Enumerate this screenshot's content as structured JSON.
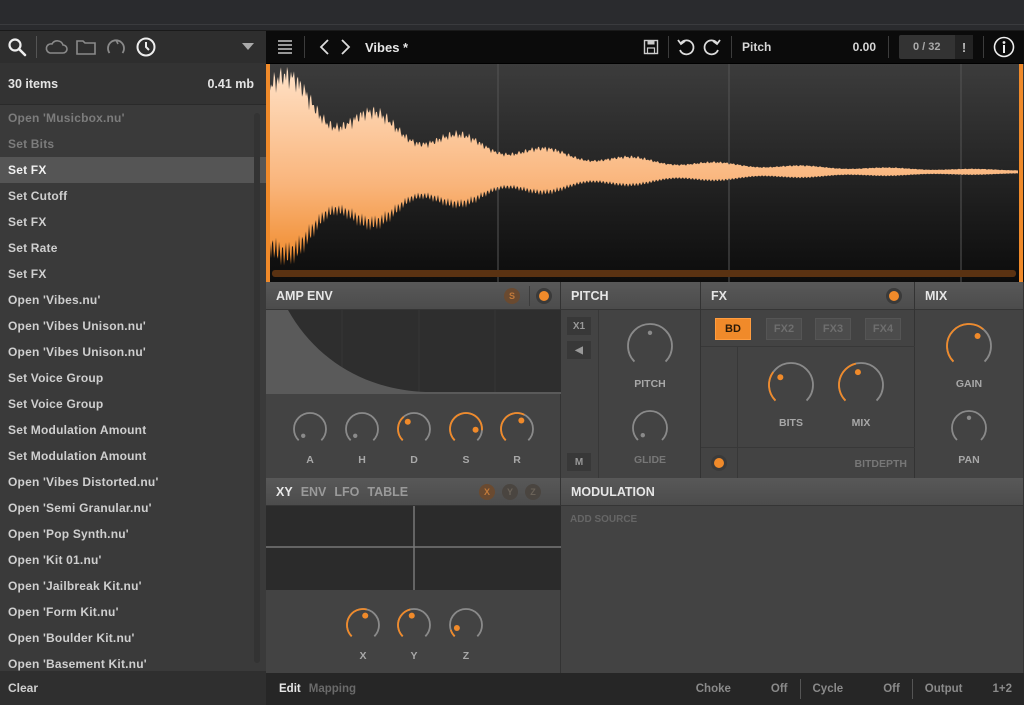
{
  "colors": {
    "accent": "#f08a2a",
    "bg": "#434343",
    "header": "#0b0b0b"
  },
  "sidebar": {
    "toolbar_icons": [
      "search-icon",
      "cloud-icon",
      "folder-icon",
      "knob-icon",
      "clock-icon"
    ],
    "summary": {
      "count": "30 items",
      "size": "0.41 mb"
    },
    "items": [
      {
        "label": "Open 'Musicbox.nu'",
        "state": "dim"
      },
      {
        "label": "Set Bits",
        "state": "dim"
      },
      {
        "label": "Set FX",
        "state": "selected"
      },
      {
        "label": "Set Cutoff",
        "state": "normal"
      },
      {
        "label": "Set FX",
        "state": "normal"
      },
      {
        "label": "Set Rate",
        "state": "normal"
      },
      {
        "label": "Set FX",
        "state": "normal"
      },
      {
        "label": "Open 'Vibes.nu'",
        "state": "normal"
      },
      {
        "label": "Open 'Vibes Unison.nu'",
        "state": "normal"
      },
      {
        "label": "Open 'Vibes Unison.nu'",
        "state": "normal"
      },
      {
        "label": "Set Voice Group",
        "state": "normal"
      },
      {
        "label": "Set Voice Group",
        "state": "normal"
      },
      {
        "label": "Set Modulation Amount",
        "state": "normal"
      },
      {
        "label": "Set Modulation Amount",
        "state": "normal"
      },
      {
        "label": "Open 'Vibes Distorted.nu'",
        "state": "normal"
      },
      {
        "label": "Open 'Semi Granular.nu'",
        "state": "normal"
      },
      {
        "label": "Open 'Pop Synth.nu'",
        "state": "normal"
      },
      {
        "label": "Open 'Kit 01.nu'",
        "state": "normal"
      },
      {
        "label": "Open 'Jailbreak Kit.nu'",
        "state": "normal"
      },
      {
        "label": "Open 'Form Kit.nu'",
        "state": "normal"
      },
      {
        "label": "Open 'Boulder Kit.nu'",
        "state": "normal"
      },
      {
        "label": "Open 'Basement Kit.nu'",
        "state": "normal"
      }
    ],
    "footer": "Clear"
  },
  "header": {
    "title": "Vibes *",
    "param_label": "Pitch",
    "param_value": "0.00",
    "counter": "0 / 32",
    "counter_alert": "!"
  },
  "amp_env": {
    "title": "AMP ENV",
    "s_button": "S",
    "knobs": [
      {
        "label": "A",
        "value": 0.0,
        "active": false
      },
      {
        "label": "H",
        "value": 0.0,
        "active": false
      },
      {
        "label": "D",
        "value": 0.35,
        "active": true
      },
      {
        "label": "S",
        "value": 0.85,
        "active": true
      },
      {
        "label": "R",
        "value": 0.6,
        "active": true
      }
    ]
  },
  "pitch": {
    "title": "PITCH",
    "buttons": [
      "X1",
      "◀",
      "M"
    ],
    "knobs": [
      {
        "label": "PITCH",
        "value": 0.5,
        "active": false
      },
      {
        "label": "GLIDE",
        "value": 0.0,
        "active": false,
        "dim": true
      }
    ]
  },
  "fx": {
    "title": "FX",
    "tabs": [
      "BD",
      "FX2",
      "FX3",
      "FX4"
    ],
    "active_tab": "BD",
    "knobs": [
      {
        "label": "BITS",
        "value": 0.3,
        "active": true
      },
      {
        "label": "MIX",
        "value": 0.45,
        "active": true
      }
    ],
    "footer_label": "BITDEPTH"
  },
  "mix": {
    "title": "MIX",
    "knobs": [
      {
        "label": "GAIN",
        "value": 0.65,
        "active": true
      },
      {
        "label": "PAN",
        "value": 0.5,
        "active": false
      }
    ]
  },
  "xy": {
    "tabs": [
      "XY",
      "ENV",
      "LFO",
      "TABLE"
    ],
    "active_tab": "XY",
    "axis_buttons": [
      "X",
      "Y",
      "Z"
    ],
    "knobs": [
      {
        "label": "X",
        "value": 0.55,
        "active": true
      },
      {
        "label": "Y",
        "value": 0.45,
        "active": true
      },
      {
        "label": "Z",
        "value": 0.1,
        "active": true
      }
    ]
  },
  "modulation": {
    "title": "MODULATION",
    "placeholder": "ADD SOURCE"
  },
  "bottom": {
    "tabs": [
      "Edit",
      "Mapping"
    ],
    "active_tab": "Edit",
    "choke_label": "Choke",
    "choke_value": "Off",
    "cycle_label": "Cycle",
    "cycle_value": "Off",
    "output_label": "Output",
    "output_value": "1+2"
  }
}
